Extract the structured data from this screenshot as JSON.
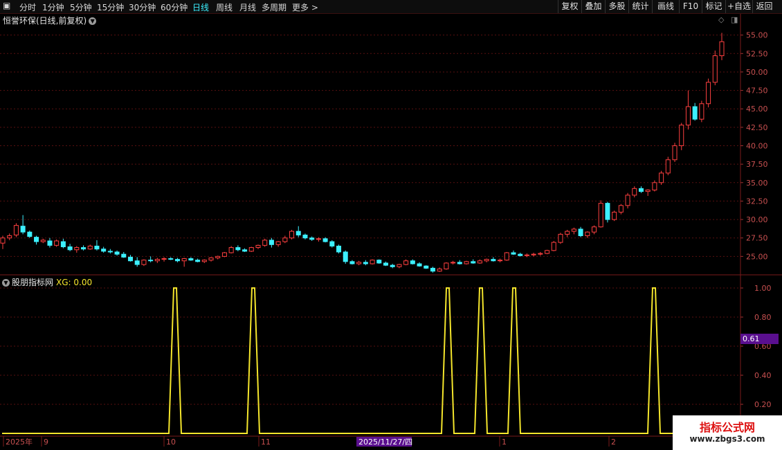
{
  "toolbar": {
    "periods": [
      {
        "label": "分时"
      },
      {
        "label": "1分钟"
      },
      {
        "label": "5分钟"
      },
      {
        "label": "15分钟"
      },
      {
        "label": "30分钟"
      },
      {
        "label": "60分钟"
      },
      {
        "label": "日线",
        "active": true
      },
      {
        "label": "周线"
      },
      {
        "label": "月线"
      },
      {
        "label": "多周期"
      },
      {
        "label": "更多 >"
      }
    ],
    "right_buttons": [
      {
        "label": "复权"
      },
      {
        "label": "叠加"
      },
      {
        "label": "多股"
      },
      {
        "label": "统计"
      },
      {
        "label": "画线"
      },
      {
        "label": "F10"
      },
      {
        "label": "标记"
      },
      {
        "label": "+自选"
      },
      {
        "label": "返回"
      }
    ]
  },
  "stock": {
    "title": "恒誉环保(日线,前复权)"
  },
  "price_axis": {
    "ticks": [
      "55.00",
      "52.50",
      "50.00",
      "47.50",
      "45.00",
      "42.50",
      "40.00",
      "37.50",
      "35.00",
      "32.50",
      "30.00",
      "27.50",
      "25.00"
    ]
  },
  "indicator": {
    "name": "股朋指标网",
    "xg_label": "XG: 0.00",
    "ticks": [
      "1.00",
      "0.80",
      "0.60",
      "0.40",
      "0.20"
    ],
    "cursor_value": "0.61",
    "signal_dates": [
      "2025-10-13",
      "2025-11-04",
      "2026-01-05",
      "2026-01-15",
      "2026-01-23",
      "2026-03-02"
    ]
  },
  "date_axis": {
    "labels": [
      "2025年",
      "9",
      "10",
      "11",
      "12",
      "1",
      "2"
    ],
    "cursor_date": "2025/11/27/四"
  },
  "watermark": {
    "line1": "指标公式网",
    "line2": "www.zbgs3.com"
  },
  "colors": {
    "up": "#ff4040",
    "down": "#3cf0ff",
    "signal": "#f5e62c",
    "grid": "#5a1010"
  },
  "chart_data": {
    "type": "candlestick",
    "title": "恒誉环保(日线,前复权)",
    "ylim": [
      22.5,
      56.0
    ],
    "ohlc": [
      [
        26.8,
        27.8,
        26.0,
        27.5
      ],
      [
        27.5,
        28.1,
        27.2,
        27.8
      ],
      [
        27.9,
        29.5,
        27.6,
        29.2
      ],
      [
        29.1,
        30.6,
        28.0,
        28.3
      ],
      [
        28.3,
        28.5,
        27.5,
        27.7
      ],
      [
        27.6,
        27.8,
        26.6,
        27.0
      ],
      [
        27.0,
        27.4,
        26.8,
        27.2
      ],
      [
        27.1,
        27.5,
        26.2,
        26.5
      ],
      [
        26.5,
        27.3,
        26.3,
        27.1
      ],
      [
        27.0,
        27.4,
        26.1,
        26.3
      ],
      [
        26.3,
        26.7,
        25.7,
        25.9
      ],
      [
        25.9,
        26.4,
        25.5,
        26.2
      ],
      [
        26.2,
        26.5,
        25.8,
        26.0
      ],
      [
        26.0,
        26.6,
        25.9,
        26.4
      ],
      [
        26.4,
        27.2,
        25.8,
        26.0
      ],
      [
        26.0,
        26.3,
        25.5,
        25.7
      ],
      [
        25.7,
        26.0,
        25.4,
        25.6
      ],
      [
        25.6,
        25.8,
        25.1,
        25.3
      ],
      [
        25.3,
        25.6,
        24.8,
        24.9
      ],
      [
        24.9,
        25.2,
        24.3,
        24.4
      ],
      [
        24.4,
        24.9,
        23.6,
        23.9
      ],
      [
        23.9,
        24.6,
        23.7,
        24.5
      ],
      [
        24.5,
        25.0,
        24.2,
        24.4
      ],
      [
        24.4,
        24.8,
        24.1,
        24.6
      ],
      [
        24.6,
        24.9,
        24.3,
        24.7
      ],
      [
        24.7,
        24.9,
        24.5,
        24.6
      ],
      [
        24.6,
        24.8,
        24.2,
        24.4
      ],
      [
        24.4,
        24.8,
        23.6,
        24.7
      ],
      [
        24.7,
        24.9,
        24.4,
        24.5
      ],
      [
        24.5,
        24.7,
        24.2,
        24.3
      ],
      [
        24.3,
        24.6,
        24.1,
        24.5
      ],
      [
        24.5,
        24.9,
        24.3,
        24.8
      ],
      [
        24.8,
        25.1,
        24.6,
        25.0
      ],
      [
        25.0,
        25.6,
        24.9,
        25.5
      ],
      [
        25.5,
        26.4,
        25.4,
        26.2
      ],
      [
        26.2,
        26.5,
        25.7,
        25.9
      ],
      [
        25.9,
        26.1,
        25.6,
        25.7
      ],
      [
        25.7,
        26.3,
        25.6,
        26.2
      ],
      [
        26.2,
        26.6,
        26.0,
        26.5
      ],
      [
        26.5,
        27.4,
        26.3,
        27.2
      ],
      [
        27.2,
        27.5,
        26.2,
        26.6
      ],
      [
        26.6,
        27.1,
        26.3,
        27.0
      ],
      [
        27.0,
        27.8,
        26.8,
        27.5
      ],
      [
        27.5,
        28.6,
        27.3,
        28.4
      ],
      [
        28.4,
        29.1,
        27.6,
        27.9
      ],
      [
        27.9,
        28.1,
        27.3,
        27.5
      ],
      [
        27.5,
        27.7,
        27.1,
        27.3
      ],
      [
        27.3,
        27.6,
        27.0,
        27.4
      ],
      [
        27.4,
        27.6,
        26.9,
        27.0
      ],
      [
        27.0,
        27.2,
        26.2,
        26.4
      ],
      [
        26.4,
        26.6,
        25.4,
        25.6
      ],
      [
        25.6,
        25.8,
        24.0,
        24.3
      ],
      [
        24.3,
        24.5,
        23.9,
        24.0
      ],
      [
        24.0,
        24.4,
        23.8,
        24.2
      ],
      [
        24.2,
        24.5,
        23.8,
        24.0
      ],
      [
        24.0,
        24.6,
        23.9,
        24.5
      ],
      [
        24.5,
        24.6,
        24.0,
        24.1
      ],
      [
        24.1,
        24.3,
        23.7,
        23.8
      ],
      [
        23.8,
        24.0,
        23.4,
        23.6
      ],
      [
        23.6,
        24.0,
        23.4,
        23.9
      ],
      [
        23.9,
        24.6,
        23.8,
        24.4
      ],
      [
        24.4,
        24.6,
        23.9,
        24.0
      ],
      [
        24.0,
        24.2,
        23.6,
        23.7
      ],
      [
        23.7,
        23.8,
        23.3,
        23.4
      ],
      [
        23.4,
        23.6,
        22.8,
        23.0
      ],
      [
        23.0,
        23.5,
        22.9,
        23.3
      ],
      [
        23.3,
        24.2,
        23.2,
        24.1
      ],
      [
        24.1,
        24.4,
        23.9,
        24.2
      ],
      [
        24.2,
        24.5,
        23.9,
        24.0
      ],
      [
        24.0,
        24.4,
        23.9,
        24.3
      ],
      [
        24.3,
        24.6,
        24.0,
        24.1
      ],
      [
        24.1,
        24.6,
        24.0,
        24.4
      ],
      [
        24.4,
        24.7,
        24.2,
        24.6
      ],
      [
        24.6,
        24.9,
        24.3,
        24.4
      ],
      [
        24.4,
        24.7,
        24.2,
        24.5
      ],
      [
        24.5,
        25.6,
        24.4,
        25.5
      ],
      [
        25.5,
        25.8,
        25.2,
        25.3
      ],
      [
        25.3,
        25.5,
        25.0,
        25.1
      ],
      [
        25.1,
        25.4,
        24.9,
        25.2
      ],
      [
        25.2,
        25.5,
        25.0,
        25.3
      ],
      [
        25.3,
        25.6,
        25.1,
        25.4
      ],
      [
        25.4,
        25.9,
        25.3,
        25.8
      ],
      [
        25.8,
        27.1,
        25.7,
        26.9
      ],
      [
        26.9,
        28.2,
        26.7,
        28.0
      ],
      [
        28.0,
        28.6,
        27.6,
        28.4
      ],
      [
        28.4,
        28.9,
        28.0,
        28.7
      ],
      [
        28.7,
        29.0,
        27.6,
        27.8
      ],
      [
        27.8,
        28.4,
        27.5,
        28.3
      ],
      [
        28.3,
        29.2,
        28.0,
        29.0
      ],
      [
        29.0,
        32.6,
        28.9,
        32.2
      ],
      [
        32.2,
        32.4,
        29.6,
        30.0
      ],
      [
        30.0,
        31.2,
        29.8,
        31.0
      ],
      [
        31.0,
        32.1,
        30.7,
        31.9
      ],
      [
        31.9,
        33.6,
        31.5,
        33.3
      ],
      [
        33.3,
        34.5,
        33.0,
        34.2
      ],
      [
        34.2,
        34.5,
        33.6,
        33.8
      ],
      [
        33.8,
        34.1,
        33.2,
        34.0
      ],
      [
        34.0,
        35.3,
        33.8,
        35.0
      ],
      [
        35.0,
        36.6,
        34.7,
        36.3
      ],
      [
        36.3,
        38.5,
        36.0,
        38.1
      ],
      [
        38.1,
        40.4,
        37.8,
        40.0
      ],
      [
        40.0,
        43.1,
        39.4,
        42.8
      ],
      [
        42.8,
        47.5,
        42.2,
        45.3
      ],
      [
        45.3,
        45.8,
        43.4,
        43.6
      ],
      [
        43.6,
        46.1,
        43.2,
        45.7
      ],
      [
        45.7,
        49.1,
        45.2,
        48.6
      ],
      [
        48.6,
        52.9,
        48.2,
        52.2
      ],
      [
        52.2,
        55.3,
        51.6,
        54.1
      ]
    ]
  }
}
